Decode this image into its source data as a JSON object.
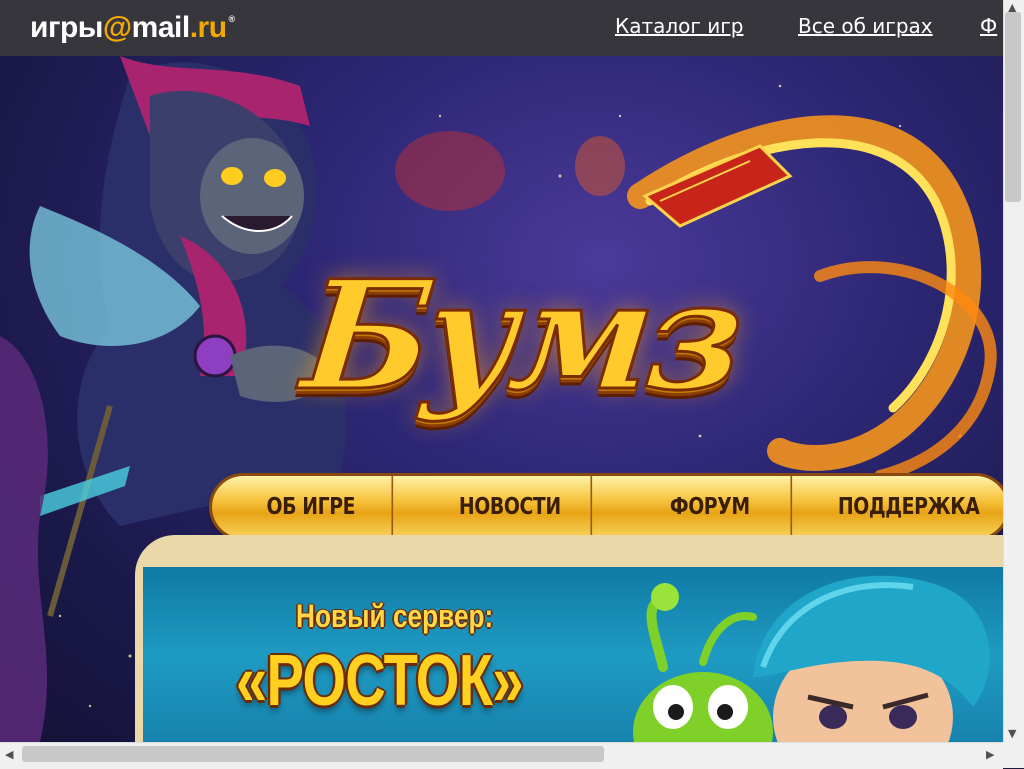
{
  "top_bar": {
    "logo_word": "игры",
    "logo_at": "@",
    "logo_mail": "mail",
    "logo_ru": ".ru",
    "logo_reg": "®",
    "links": [
      {
        "label": "Каталог игр"
      },
      {
        "label": "Все об играх"
      },
      {
        "label": "Ф"
      }
    ]
  },
  "hero": {
    "game_title": "Бумз"
  },
  "nav": {
    "items": [
      {
        "label": "ОБ ИГРЕ"
      },
      {
        "label": "НОВОСТИ"
      },
      {
        "label": "ФОРУМ"
      },
      {
        "label": "ПОДДЕРЖКА"
      }
    ]
  },
  "banner": {
    "subtitle": "Новый сервер:",
    "title": "«РОСТОК»"
  },
  "scrollbars": {
    "up_arrow": "▲",
    "down_arrow": "▼",
    "left_arrow": "◀",
    "right_arrow": "▶"
  },
  "colors": {
    "top_bar": "#36363c",
    "logo_accent": "#f5a800",
    "title_gold": "#ffcb2c",
    "nav_gold": "#f6c23c",
    "banner_blue": "#1f9bc3"
  }
}
